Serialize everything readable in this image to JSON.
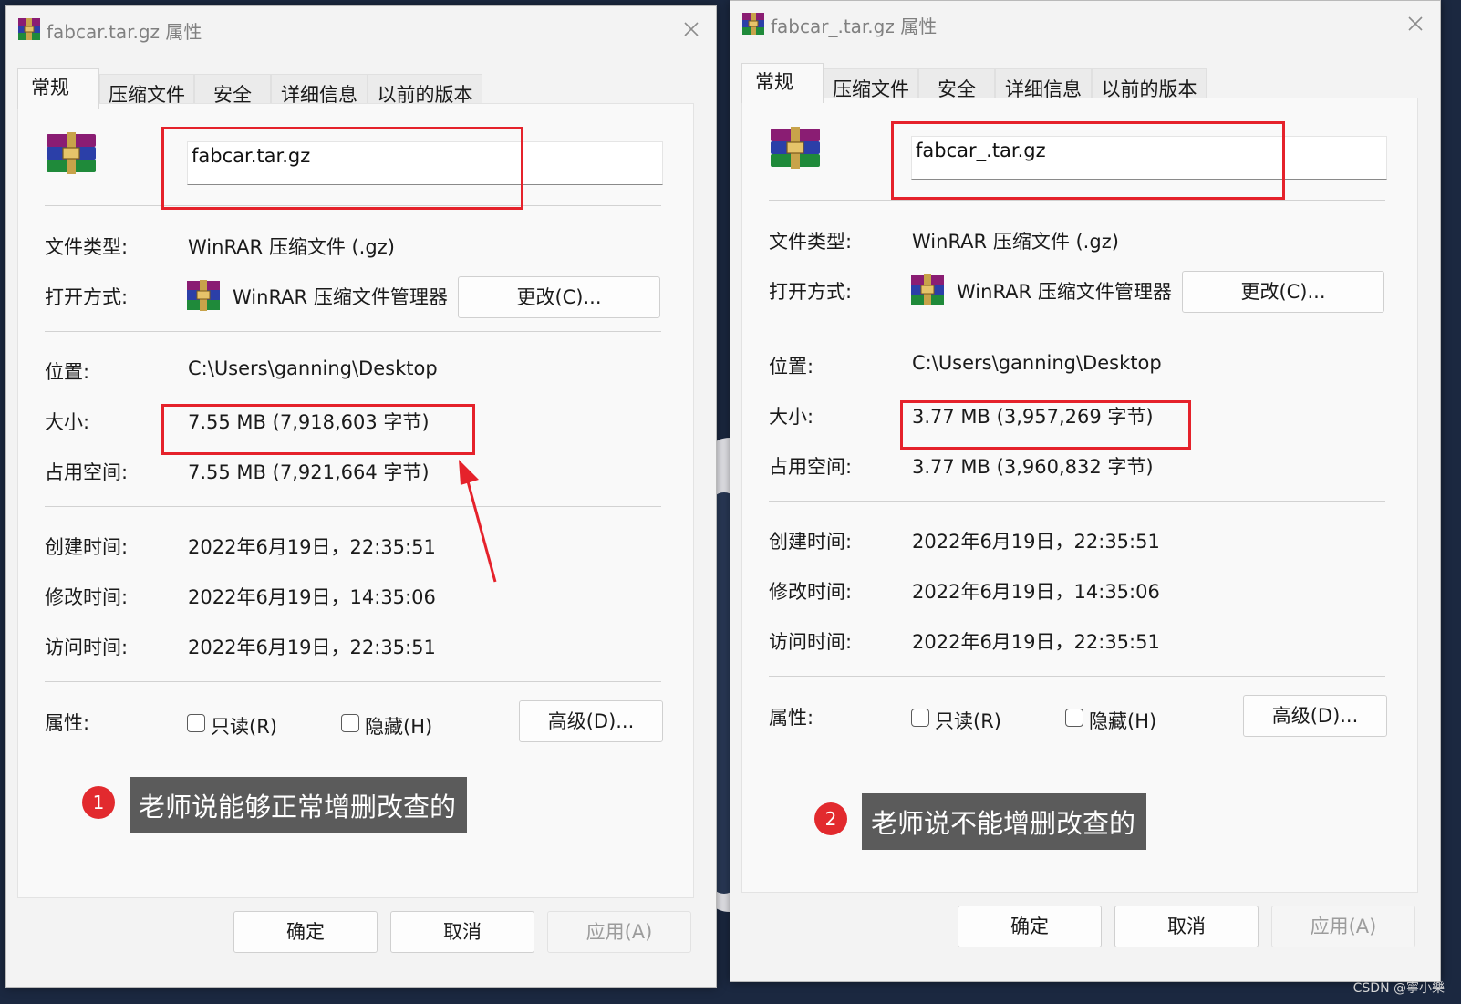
{
  "windows": [
    {
      "title": "fabcar.tar.gz 属性",
      "tabs": [
        "常规",
        "压缩文件",
        "安全",
        "详细信息",
        "以前的版本"
      ],
      "filename": "fabcar.tar.gz",
      "fields": {
        "type_label": "文件类型:",
        "type_value": "WinRAR 压缩文件 (.gz)",
        "open_label": "打开方式:",
        "open_value": "WinRAR 压缩文件管理器",
        "change_button": "更改(C)...",
        "location_label": "位置:",
        "location_value": "C:\\Users\\ganning\\Desktop",
        "size_label": "大小:",
        "size_value": "7.55 MB (7,918,603 字节)",
        "disk_label": "占用空间:",
        "disk_value": "7.55 MB (7,921,664 字节)",
        "created_label": "创建时间:",
        "created_value": "2022年6月19日，22:35:51",
        "modified_label": "修改时间:",
        "modified_value": "2022年6月19日，14:35:06",
        "accessed_label": "访问时间:",
        "accessed_value": "2022年6月19日，22:35:51",
        "attr_label": "属性:",
        "readonly_label": "只读(R)",
        "readonly_checked": false,
        "hidden_label": "隐藏(H)",
        "hidden_checked": false,
        "advanced_button": "高级(D)..."
      },
      "buttons": {
        "ok": "确定",
        "cancel": "取消",
        "apply": "应用(A)"
      },
      "annotation": {
        "number": "1",
        "text": "老师说能够正常增删改查的"
      }
    },
    {
      "title": "fabcar_.tar.gz 属性",
      "tabs": [
        "常规",
        "压缩文件",
        "安全",
        "详细信息",
        "以前的版本"
      ],
      "filename": "fabcar_.tar.gz",
      "fields": {
        "type_label": "文件类型:",
        "type_value": "WinRAR 压缩文件 (.gz)",
        "open_label": "打开方式:",
        "open_value": "WinRAR 压缩文件管理器",
        "change_button": "更改(C)...",
        "location_label": "位置:",
        "location_value": "C:\\Users\\ganning\\Desktop",
        "size_label": "大小:",
        "size_value": "3.77 MB (3,957,269 字节)",
        "disk_label": "占用空间:",
        "disk_value": "3.77 MB (3,960,832 字节)",
        "created_label": "创建时间:",
        "created_value": "2022年6月19日，22:35:51",
        "modified_label": "修改时间:",
        "modified_value": "2022年6月19日，14:35:06",
        "accessed_label": "访问时间:",
        "accessed_value": "2022年6月19日，22:35:51",
        "attr_label": "属性:",
        "readonly_label": "只读(R)",
        "readonly_checked": false,
        "hidden_label": "隐藏(H)",
        "hidden_checked": false,
        "advanced_button": "高级(D)..."
      },
      "buttons": {
        "ok": "确定",
        "cancel": "取消",
        "apply": "应用(A)"
      },
      "annotation": {
        "number": "2",
        "text": "老师说不能增删改查的"
      }
    }
  ],
  "watermark": "CSDN @寧小樂",
  "colors": {
    "highlight": "#e5222b",
    "annotation_bg": "#5b5b5b",
    "badge": "#e22a2e"
  }
}
